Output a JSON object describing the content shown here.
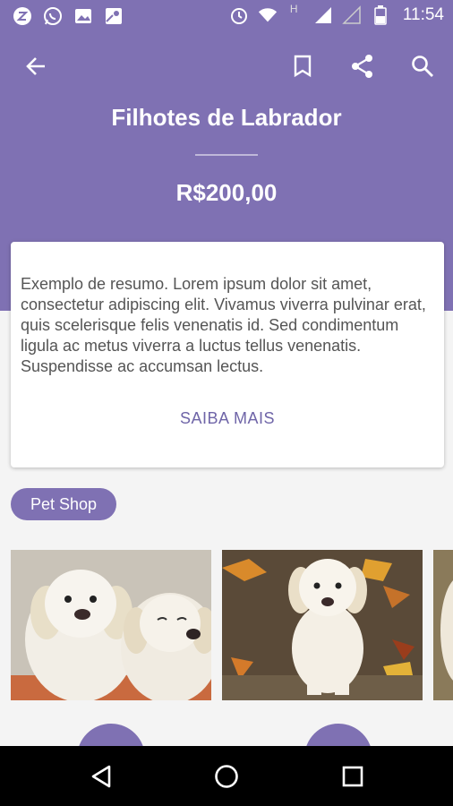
{
  "status_bar": {
    "time": "11:54",
    "left_icons": [
      "z-app-icon",
      "whatsapp-icon",
      "image-icon",
      "maps-icon"
    ],
    "right_icons": [
      "alarm-icon",
      "wifi-icon",
      "signal-icon",
      "signal-empty-icon",
      "battery-icon"
    ],
    "network_label": "H"
  },
  "toolbar": {
    "back_icon": "arrow-back-icon",
    "bookmark_icon": "bookmark-icon",
    "share_icon": "share-icon",
    "search_icon": "search-icon"
  },
  "product": {
    "title": "Filhotes de Labrador",
    "price": "R$200,00"
  },
  "card": {
    "summary": "Exemplo de resumo. Lorem ipsum dolor sit amet, consectetur adipiscing elit. Vivamus viverra pulvinar erat, quis scelerisque felis venenatis id. Sed condimentum ligula ac metus viverra a luctus tellus venenatis. Suspendisse ac accumsan lectus.",
    "more_label": "SAIBA MAIS"
  },
  "category_chip": "Pet Shop",
  "gallery": [
    "labrador-puppies-photo",
    "labrador-puppy-leaves-photo",
    "puppy-photo-partial"
  ],
  "nav": {
    "back_icon": "triangle-back-icon",
    "home_icon": "circle-home-icon",
    "recents_icon": "square-recents-icon"
  },
  "colors": {
    "primary": "#7f71b3",
    "accent_text": "#6f65a8",
    "background": "#f4f4f4"
  }
}
